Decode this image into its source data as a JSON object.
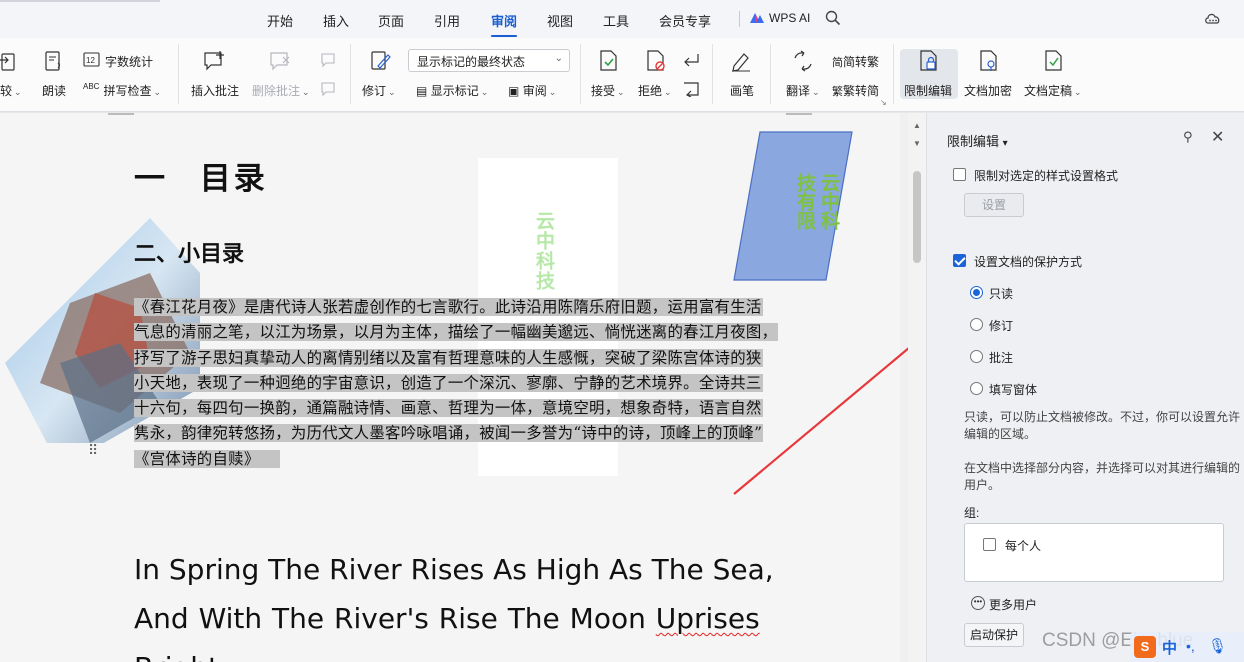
{
  "menubar": {
    "tabs": [
      {
        "label": "开始"
      },
      {
        "label": "插入"
      },
      {
        "label": "页面"
      },
      {
        "label": "引用"
      },
      {
        "label": "审阅",
        "active": true
      },
      {
        "label": "视图"
      },
      {
        "label": "工具"
      },
      {
        "label": "会员专享"
      }
    ],
    "ai_label": "WPS AI"
  },
  "ribbon": {
    "compare": "比较",
    "read_aloud": "朗读",
    "word_count": "字数统计",
    "spell_check": "拼写检查",
    "insert_comment": "插入批注",
    "delete_comment": "删除批注",
    "track_changes": "修订",
    "markup_state": "显示标记的最终状态",
    "show_markup": "显示标记",
    "review_pane": "审阅",
    "accept": "接受",
    "reject": "拒绝",
    "pen": "画笔",
    "translate": "翻译",
    "to_traditional": "简转繁",
    "to_simplified": "繁转简",
    "restrict_editing": "限制编辑",
    "encrypt": "文档加密",
    "finalize": "文档定稿"
  },
  "document": {
    "heading1": "一 目录",
    "heading2": "二、小目录",
    "paragraph_lines": [
      "《春江花月夜》是唐代诗人张若虚创作的七言歌行。此诗沿用陈隋乐府旧题，运用富有生活",
      "气息的清丽之笔，以江为场景，以月为主体，描绘了一幅幽美邈远、惝恍迷离的春江月夜图，",
      "抒写了游子思妇真挚动人的离情别绪以及富有哲理意味的人生感慨，突破了梁陈宫体诗的狭",
      "小天地，表现了一种迥绝的宇宙意识，创造了一个深沉、寥廓、宁静的艺术境界。全诗共三",
      "十六句，每四句一换韵，通篇融诗情、画意、哲理为一体，意境空明，想象奇特，语言自然",
      "隽永，韵律宛转悠扬，为历代文人墨客吟咏唱诵，被闻一多誉为“诗中的诗，顶峰上的顶峰”",
      "《宫体诗的自赎》"
    ],
    "english_lines": [
      "In Spring The River Rises As High As The Sea,",
      "And With The River's Rise The Moon ",
      "Bright"
    ],
    "english_squiggle_word": "Uprises",
    "shape_text_col1": "云中科",
    "shape_text_col2": "技有限",
    "vertical_text": "云中科技"
  },
  "panel": {
    "title": "限制编辑",
    "restrict_formatting": "限制对选定的样式设置格式",
    "settings_button": "设置",
    "set_protection": "设置文档的保护方式",
    "options": [
      {
        "label": "只读",
        "checked": true
      },
      {
        "label": "修订",
        "checked": false
      },
      {
        "label": "批注",
        "checked": false
      },
      {
        "label": "填写窗体",
        "checked": false
      }
    ],
    "desc1": "只读，可以防止文档被修改。不过，你可以设置允许编辑的区域。",
    "desc2": "在文档中选择部分内容，并选择可以对其进行编辑的用户。",
    "group_label": "组:",
    "everyone": "每个人",
    "more_users": "更多用户",
    "start_protect": "启动保护"
  },
  "watermark": "CSDN @Eiceblue",
  "ime": {
    "logo": "S",
    "mode": "中"
  },
  "colors": {
    "accent": "#1a5fd1",
    "shape_fill": "#8aa7df",
    "shape_text": "#7dc242",
    "arrow": "#e8373b"
  }
}
